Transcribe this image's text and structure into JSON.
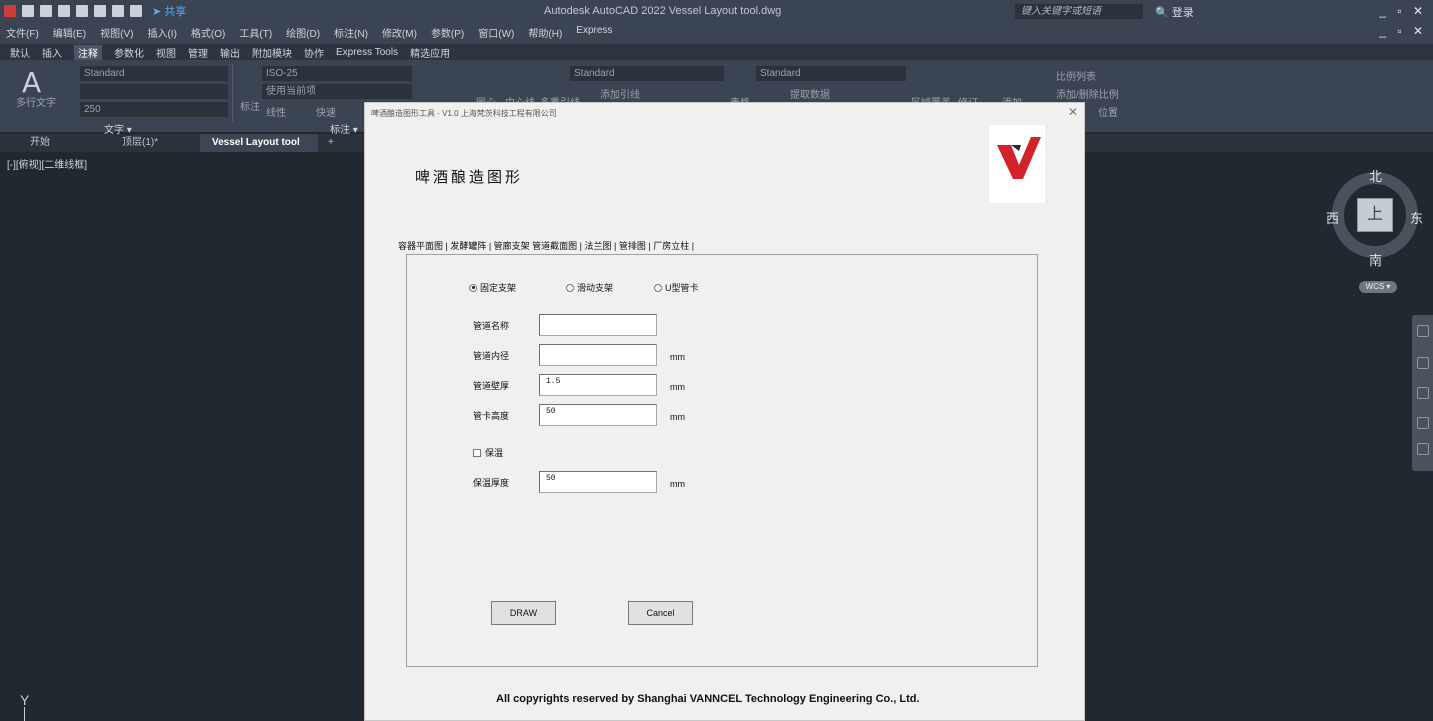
{
  "titlebar": {
    "app_title": "Autodesk AutoCAD 2022   Vessel Layout tool.dwg",
    "share_label": "共享",
    "search_placeholder": "键入关键字或短语",
    "login_label": "登录",
    "window_controls": "_ ▫ ✕",
    "doc_controls": "_ ▫ ✕"
  },
  "menubar": [
    "文件(F)",
    "编辑(E)",
    "视图(V)",
    "插入(I)",
    "格式(O)",
    "工具(T)",
    "绘图(D)",
    "标注(N)",
    "修改(M)",
    "参数(P)",
    "窗口(W)",
    "帮助(H)",
    "Express"
  ],
  "ribbon_tabs": [
    "默认",
    "插入",
    "注释",
    "参数化",
    "视图",
    "管理",
    "输出",
    "附加模块",
    "协作",
    "Express Tools",
    "精选应用"
  ],
  "ribbon_active_tab": "注释",
  "ribbon": {
    "text_style": "Standard",
    "text_height": "250",
    "multiline_text": "多行文字",
    "text_panel": "文字 ▾",
    "dim_style": "ISO-25",
    "use_current": "使用当前项",
    "dim_label": "标注",
    "linear": "线性",
    "quick": "快速",
    "dim_panel": "标注 ▾",
    "leader_style": "Standard",
    "add_leader": "添加引线",
    "table_style": "Standard",
    "extract_data": "提取数据",
    "center_mark": "圆心",
    "center_line": "中心线",
    "multileader": "多重引线",
    "table": "表格",
    "wipeout": "区域覆盖",
    "revcloud": "修订",
    "add": "添加",
    "scale_list": "比例列表",
    "add_delete_scale": "添加/删除比例",
    "sync_position": "位置"
  },
  "doc_tabs": [
    {
      "label": "开始",
      "active": false
    },
    {
      "label": "顶层(1)*",
      "active": false
    },
    {
      "label": "Vessel Layout tool",
      "active": true
    }
  ],
  "viewport_label": "[-][俯视][二维线框]",
  "viewcube": {
    "north": "北",
    "south": "南",
    "east": "东",
    "west": "西",
    "face": "上",
    "wcs": "WCS ▾"
  },
  "ucs_label": "Y",
  "dialog": {
    "title": "啤酒酿造图形工具 - V1.0  上海梵茨科技工程有限公司",
    "heading": "啤酒酿造图形",
    "tabs": "容器平面图 | 发酵罐阵 | 管廊支架  管道截面图 | 法兰图 | 管排图 | 厂房立柱 |",
    "radios": [
      {
        "label": "固定支架",
        "checked": true
      },
      {
        "label": "滑动支架",
        "checked": false
      },
      {
        "label": "U型管卡",
        "checked": false
      }
    ],
    "fields": [
      {
        "label": "管道名称",
        "value": "",
        "unit": ""
      },
      {
        "label": "管道内径",
        "value": "",
        "unit": "mm"
      },
      {
        "label": "管道壁厚",
        "value": "1.5",
        "unit": "mm"
      },
      {
        "label": "管卡高度",
        "value": "50",
        "unit": "mm"
      }
    ],
    "insulation_checkbox": "保温",
    "insulation_field": {
      "label": "保温厚度",
      "value": "50",
      "unit": "mm"
    },
    "draw_button": "DRAW",
    "cancel_button": "Cancel",
    "copyright": "All copyrights reserved by Shanghai VANNCEL Technology Engineering Co., Ltd."
  },
  "colors": {
    "logo_red": "#d3222a",
    "workspace_bg": "#212830",
    "ribbon_bg": "#3b4453"
  }
}
